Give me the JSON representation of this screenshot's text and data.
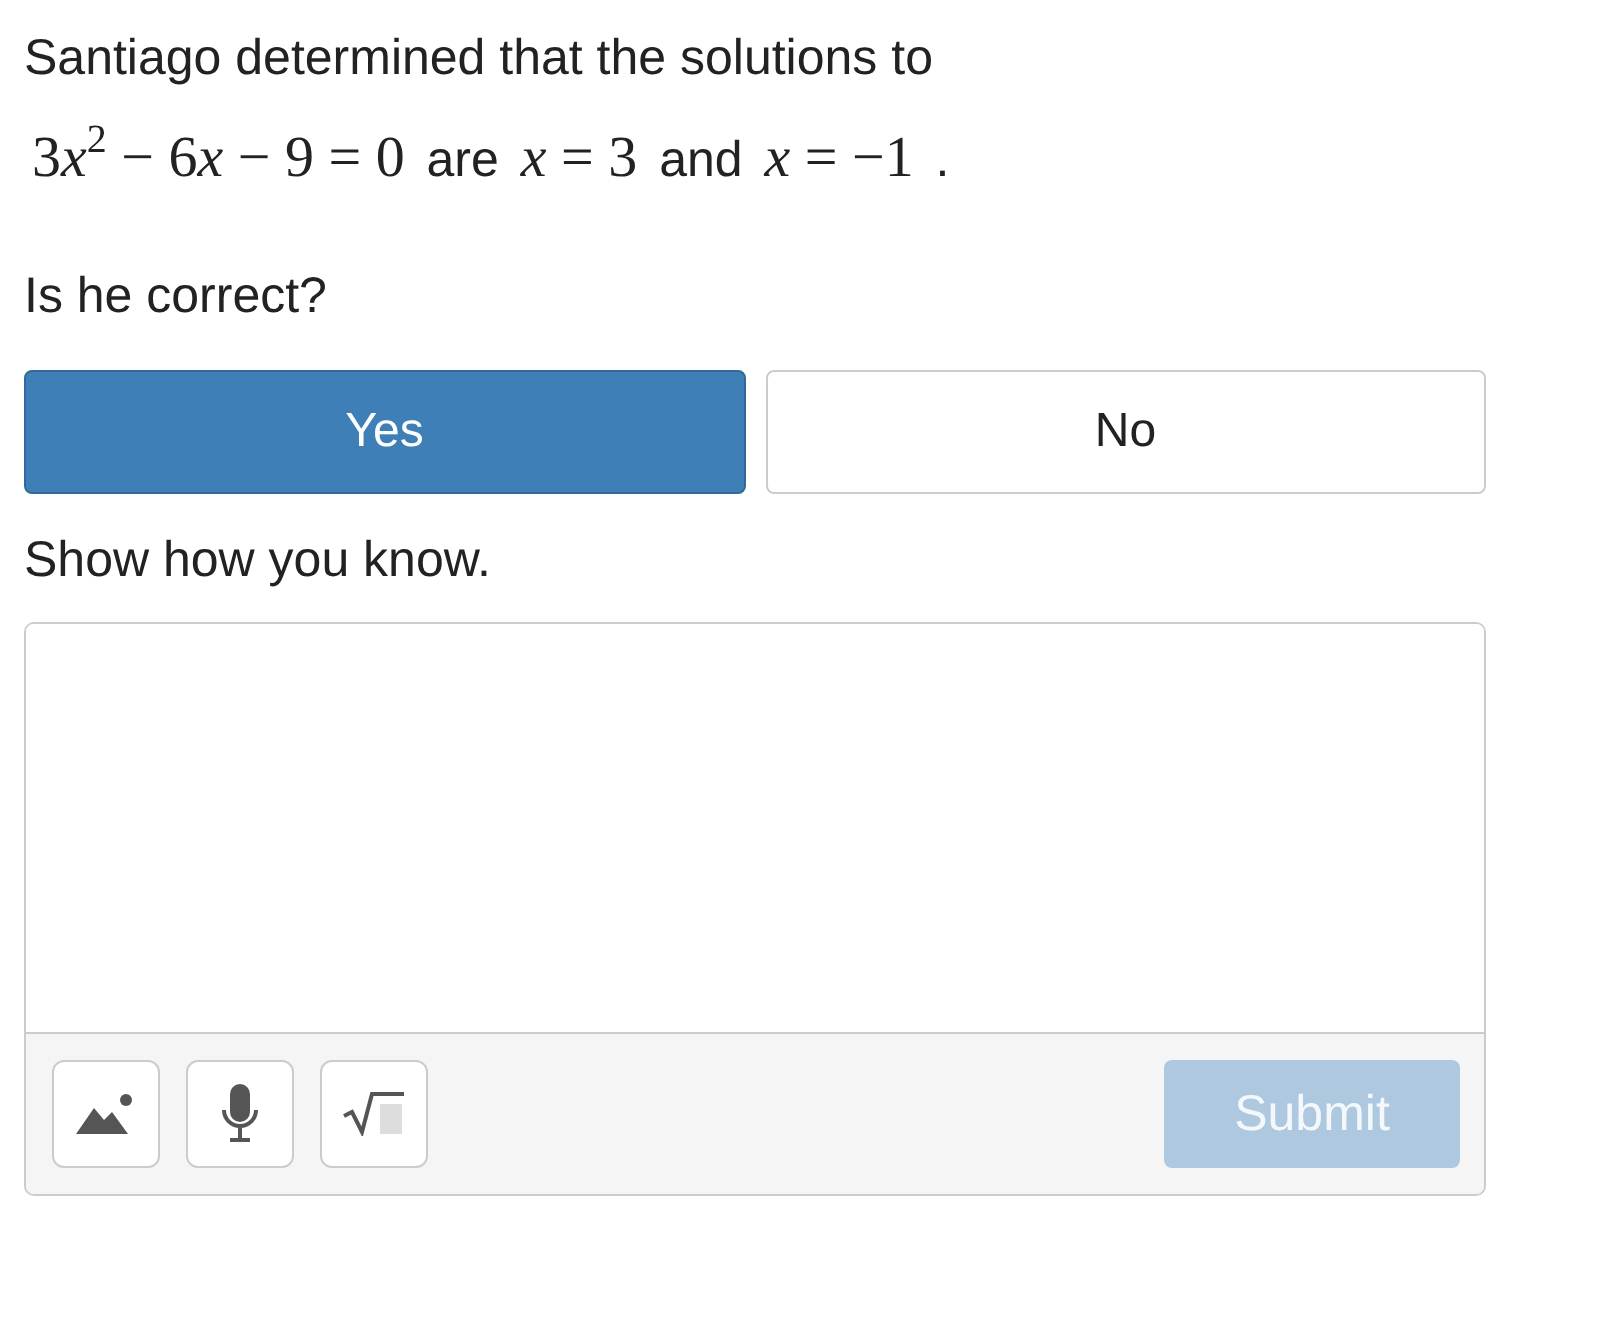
{
  "prompt": [
    {
      "kind": "text",
      "text": "Santiago determined that the solutions to"
    },
    {
      "kind": "math",
      "parts": [
        {
          "kind": "num",
          "text": "3"
        },
        {
          "kind": "var",
          "text": "x"
        },
        {
          "kind": "sup",
          "text": "2"
        },
        {
          "kind": "num",
          "text": " − 6"
        },
        {
          "kind": "var",
          "text": "x"
        },
        {
          "kind": "num",
          "text": " − 9 = 0"
        }
      ]
    },
    {
      "kind": "text",
      "text": "are"
    },
    {
      "kind": "math",
      "parts": [
        {
          "kind": "var",
          "text": "x"
        },
        {
          "kind": "num",
          "text": " = 3"
        }
      ]
    },
    {
      "kind": "text",
      "text": "and"
    },
    {
      "kind": "math",
      "parts": [
        {
          "kind": "var",
          "text": "x"
        },
        {
          "kind": "num",
          "text": " = −1"
        }
      ]
    },
    {
      "kind": "text",
      "text": "."
    }
  ],
  "question": "Is he correct?",
  "choices": [
    {
      "label": "Yes",
      "selected": true
    },
    {
      "label": "No",
      "selected": false
    }
  ],
  "response": {
    "label": "Show how you know.",
    "tools": [
      {
        "kind": "image"
      },
      {
        "kind": "microphone"
      },
      {
        "kind": "math"
      }
    ],
    "submit": {
      "label": "Submit",
      "disabled": true
    }
  }
}
